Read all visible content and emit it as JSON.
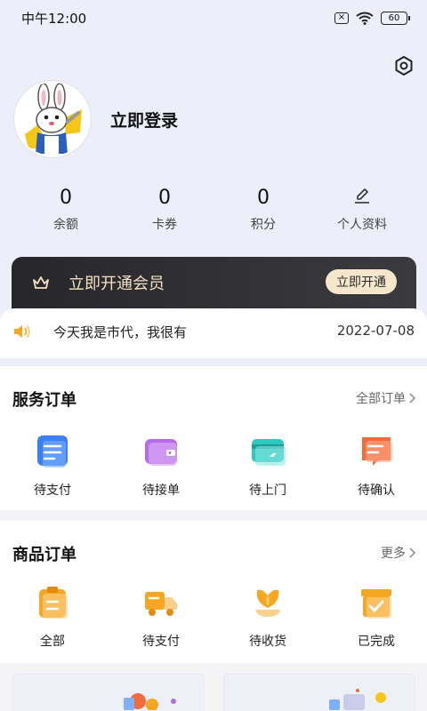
{
  "status_bar": {
    "time": "中午12:00",
    "battery": "60"
  },
  "profile": {
    "login_label": "立即登录"
  },
  "stats": [
    {
      "value": "0",
      "label": "余额"
    },
    {
      "value": "0",
      "label": "卡券"
    },
    {
      "value": "0",
      "label": "积分"
    },
    {
      "value": "",
      "label": "个人资料"
    }
  ],
  "member": {
    "title": "立即开通会员",
    "button": "立即开通"
  },
  "notice": {
    "text": "今天我是市代，我很有",
    "date": "2022-07-08"
  },
  "service_orders": {
    "title": "服务订单",
    "link": "全部订单",
    "items": [
      {
        "label": "待支付",
        "icon": "document-icon"
      },
      {
        "label": "待接单",
        "icon": "wallet-icon"
      },
      {
        "label": "待上门",
        "icon": "card-icon"
      },
      {
        "label": "待确认",
        "icon": "message-icon"
      }
    ]
  },
  "goods_orders": {
    "title": "商品订单",
    "link": "更多",
    "items": [
      {
        "label": "全部",
        "icon": "clipboard-icon"
      },
      {
        "label": "待支付",
        "icon": "truck-icon"
      },
      {
        "label": "待收货",
        "icon": "flower-icon"
      },
      {
        "label": "已完成",
        "icon": "box-check-icon"
      }
    ]
  },
  "colors": {
    "accent_orange": "#f5a623",
    "member_gold": "#f3e2c4"
  }
}
